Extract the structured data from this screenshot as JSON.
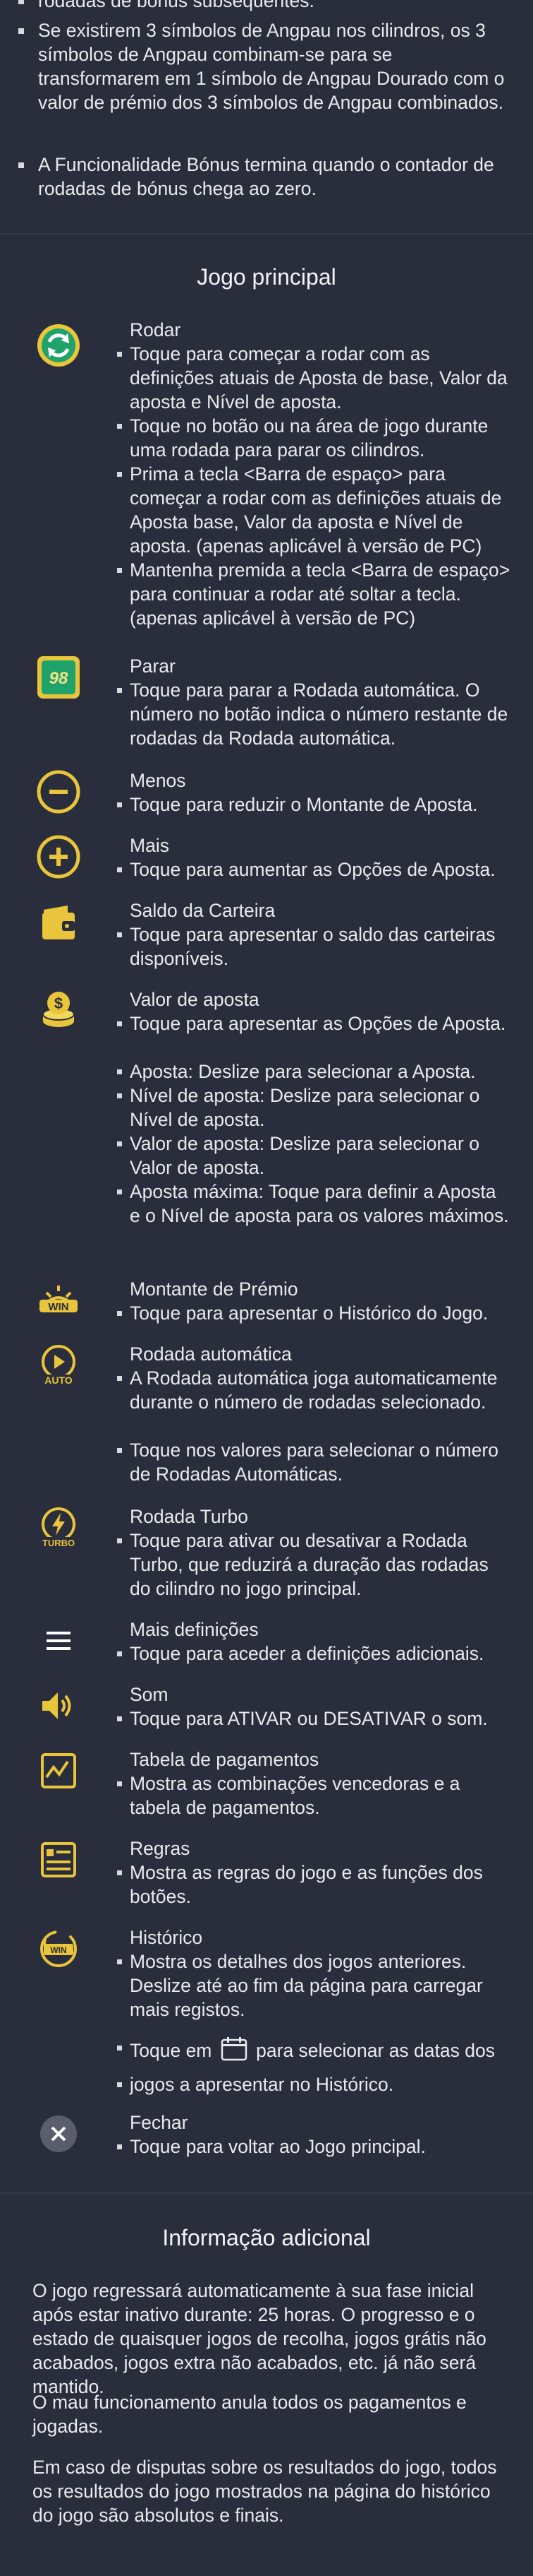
{
  "intro": {
    "partial_line": "rodadas de bónus subsequentes.",
    "bullets": [
      "Se existirem 3 símbolos de Angpau nos cilindros, os 3 símbolos de Angpau combinam-se para se transformarem em 1 símbolo de Angpau Dourado com o valor de prémio dos 3 símbolos de Angpau combinados.",
      "A Funcionalidade Bónus termina quando o contador de rodadas de bónus chega ao zero."
    ]
  },
  "main_game": {
    "title": "Jogo principal",
    "items": [
      {
        "icon": "spin-icon",
        "title": "Rodar",
        "bullets": [
          "Toque para começar a rodar com as definições atuais de Aposta de base, Valor da aposta e Nível de aposta.",
          "Toque no botão ou na área de jogo durante uma rodada para parar os cilindros.",
          "Prima a tecla <Barra de espaço> para começar a rodar com as definições atuais de Aposta base, Valor da aposta e Nível de aposta. (apenas aplicável à versão de PC)",
          "Mantenha premida a tecla <Barra de espaço> para continuar a rodar até soltar a tecla. (apenas aplicável à versão de PC)"
        ]
      },
      {
        "icon": "stop-autospin-icon",
        "icon_text": "98",
        "title": "Parar",
        "bullets": [
          "Toque para parar a Rodada automática. O número no botão indica o número restante de rodadas da Rodada automática."
        ]
      },
      {
        "icon": "minus-icon",
        "title": "Menos",
        "bullets": [
          "Toque para reduzir o Montante de Aposta."
        ]
      },
      {
        "icon": "plus-icon",
        "title": "Mais",
        "bullets": [
          "Toque para aumentar as Opções de Aposta."
        ]
      },
      {
        "icon": "wallet-icon",
        "title": "Saldo da Carteira",
        "bullets": [
          "Toque para apresentar o saldo das carteiras disponíveis."
        ]
      },
      {
        "icon": "coins-icon",
        "title": "Valor de aposta",
        "bullets": [
          "Toque para apresentar as Opções de Aposta.",
          "Aposta: Deslize para selecionar a Aposta.",
          "Nível de aposta: Deslize para selecionar o Nível de aposta.",
          "Valor de aposta: Deslize para selecionar o Valor de aposta.",
          "Aposta máxima: Toque para definir a Aposta e o Nível de aposta para os valores máximos."
        ]
      },
      {
        "icon": "win-icon",
        "icon_text": "WIN",
        "title": "Montante de Prémio",
        "bullets": [
          "Toque para apresentar o Histórico do Jogo."
        ]
      },
      {
        "icon": "auto-spin-icon",
        "icon_text": "AUTO",
        "title": "Rodada automática",
        "bullets": [
          "A Rodada automática joga automaticamente durante o número de rodadas selecionado.",
          "Toque nos valores para selecionar o número de Rodadas Automáticas."
        ]
      },
      {
        "icon": "turbo-icon",
        "icon_text": "TURBO",
        "title": "Rodada Turbo",
        "bullets": [
          "Toque para ativar ou desativar a Rodada Turbo, que reduzirá a duração das rodadas do cilindro no jogo principal."
        ]
      },
      {
        "icon": "menu-icon",
        "title": "Mais definições",
        "bullets": [
          "Toque para aceder a definições adicionais."
        ]
      },
      {
        "icon": "sound-icon",
        "title": "Som",
        "bullets": [
          "Toque para ATIVAR ou DESATIVAR o som."
        ]
      },
      {
        "icon": "paytable-icon",
        "title": "Tabela de pagamentos",
        "bullets": [
          "Mostra as combinações vencedoras e a tabela de pagamentos."
        ]
      },
      {
        "icon": "rules-icon",
        "title": "Regras",
        "bullets": [
          "Mostra as regras do jogo e as funções dos botões."
        ]
      },
      {
        "icon": "history-icon",
        "icon_text": "WIN",
        "title": "Histórico",
        "bullets": [
          "Mostra os detalhes dos jogos anteriores. Deslize até ao fim da página para carregar mais registos."
        ],
        "calendar_bullet": {
          "before": "Toque em",
          "after": "para selecionar as datas dos",
          "line2": "jogos a apresentar no Histórico."
        }
      },
      {
        "icon": "close-icon",
        "title": "Fechar",
        "bullets": [
          "Toque para voltar ao Jogo principal."
        ]
      }
    ]
  },
  "additional_info": {
    "title": "Informação adicional",
    "paragraphs": [
      "O jogo regressará automaticamente à sua fase inicial após estar inativo durante: 25 horas. O progresso e o estado de quaisquer jogos de recolha, jogos grátis não acabados, jogos extra não acabados, etc. já não será mantido.",
      "O mau funcionamento anula todos os pagamentos e jogadas.",
      "Em caso de disputas sobre os resultados do jogo, todos os resultados do jogo mostrados na página do histórico do jogo são absolutos e finais."
    ]
  },
  "colors": {
    "background": "#2a2d3c",
    "icon_gold": "#e8c53a",
    "icon_green": "#1fa36a",
    "divider": "#353949"
  }
}
